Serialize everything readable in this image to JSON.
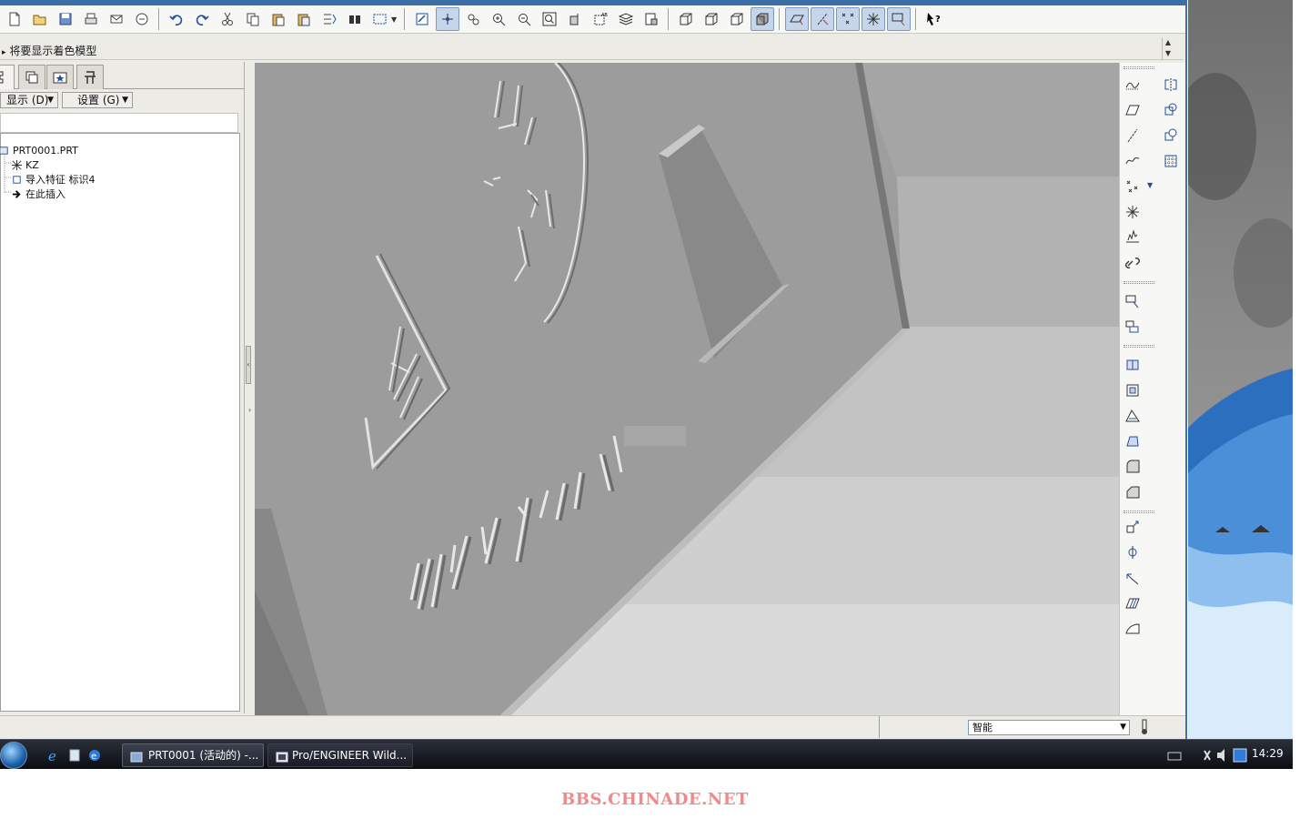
{
  "window": {
    "message": "将要显示着色模型"
  },
  "navigator": {
    "display_label": "显示 (D)",
    "settings_label": "设置 (G)",
    "tree": [
      {
        "label": "PRT0001.PRT",
        "icon": "part-icon"
      },
      {
        "label": "KZ",
        "icon": "csys-icon"
      },
      {
        "label": "导入特征 标识4",
        "icon": "import-feature-icon"
      },
      {
        "label": "在此插入",
        "icon": "insert-here-arrow-icon"
      }
    ]
  },
  "model_text": "HDE TOCTA",
  "status": {
    "filter_value": "智能"
  },
  "taskbar": {
    "tasks": [
      {
        "label": "PRT0001 (活动的) -...",
        "icon": "proe-window-icon"
      },
      {
        "label": "Pro/ENGINEER Wild...",
        "icon": "proe-window-icon"
      }
    ],
    "clock": "14:29"
  },
  "watermark": "BBS.CHINADE.NET",
  "colors": {
    "accent": "#3a6ea5",
    "toolbar_active": "#c6d6ea",
    "watermark": "#f08a8a",
    "model_face": "#9a9a9a"
  }
}
